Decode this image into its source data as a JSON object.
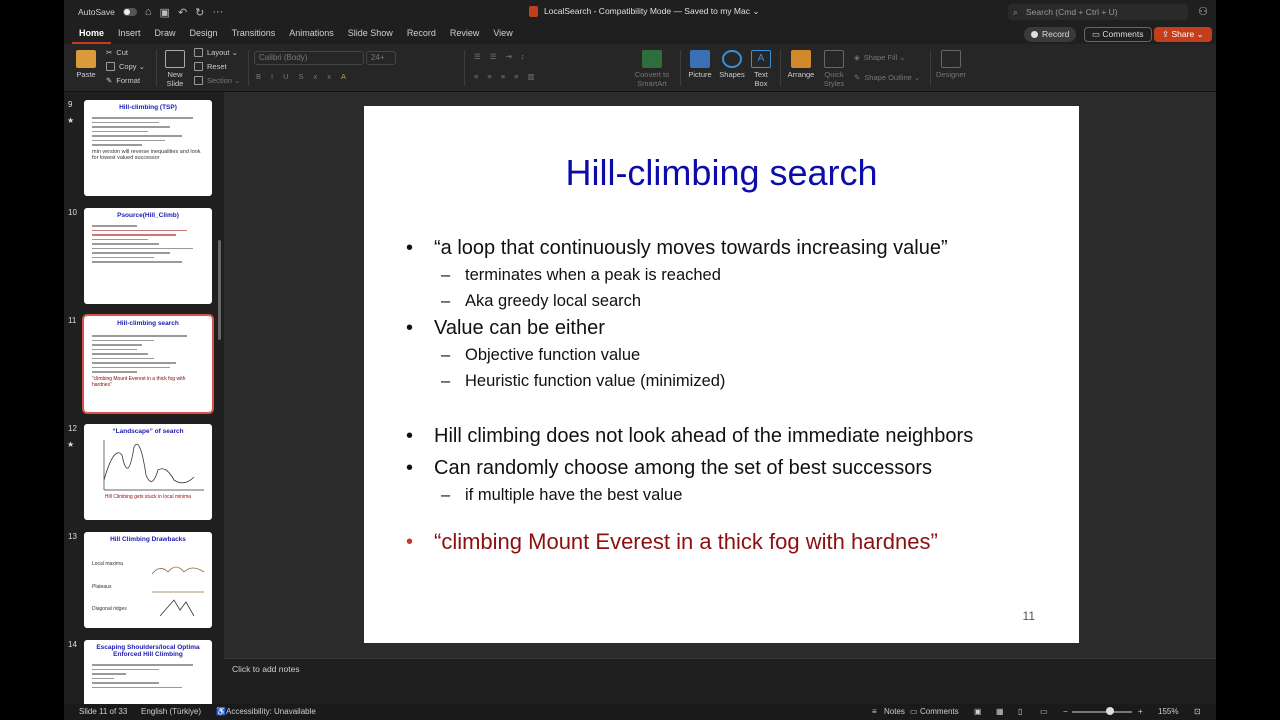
{
  "titlebar": {
    "autosave_label": "AutoSave",
    "document_title": "LocalSearch  -  Compatibility Mode  — Saved to my Mac ⌄",
    "search_placeholder": "Search (Cmd + Ctrl + U)"
  },
  "ribbon_tabs": [
    "Home",
    "Insert",
    "Draw",
    "Design",
    "Transitions",
    "Animations",
    "Slide Show",
    "Record",
    "Review",
    "View"
  ],
  "header_buttons": {
    "record": "Record",
    "comments": "Comments",
    "share": "Share ⌄"
  },
  "ribbon": {
    "paste": "Paste",
    "cut": "Cut",
    "copy": "Copy ⌄",
    "format": "Format",
    "new_slide": "New Slide",
    "layout": "Layout ⌄",
    "reset": "Reset",
    "section": "Section ⌄",
    "font_name": "Calibri (Body)",
    "font_size": "24+",
    "convert_smartart": "Convert to SmartArt",
    "picture": "Picture",
    "shapes": "Shapes",
    "text_box": "Text Box",
    "arrange": "Arrange",
    "quick_styles": "Quick Styles",
    "shape_fill": "Shape Fill ⌄",
    "shape_outline": "Shape Outline ⌄",
    "designer": "Designer"
  },
  "thumbnails": [
    {
      "num": "9",
      "title": "Hill-climbing (TSP)",
      "footer": "min version will reverse inequalities and look for lowest valued successor",
      "star": true
    },
    {
      "num": "10",
      "title": "Psource(Hill_Climb)",
      "footer": "",
      "star": false
    },
    {
      "num": "11",
      "title": "Hill-climbing search",
      "footer": "“climbing Mount Everest in a thick fog with hardnes”",
      "star": false
    },
    {
      "num": "12",
      "title": "“Landscape” of search",
      "footer": "Hill Climbing gets stuck in local minima",
      "star": true
    },
    {
      "num": "13",
      "title": "Hill Climbing Drawbacks",
      "footer": "",
      "star": false
    },
    {
      "num": "14",
      "title": "Escaping Shoulders/local Optima Enforced Hill Climbing",
      "footer": "",
      "star": false
    }
  ],
  "thumb13_items": [
    "Local maxima",
    "Plateaux",
    "Diagonal ridges"
  ],
  "slide": {
    "title": "Hill-climbing search",
    "bullets": [
      {
        "level": 1,
        "text": "“a loop that continuously moves towards increasing value”"
      },
      {
        "level": 2,
        "text": "terminates when a peak is reached"
      },
      {
        "level": 2,
        "text": "Aka greedy local search"
      },
      {
        "level": 1,
        "text": "Value can be either"
      },
      {
        "level": 2,
        "text": "Objective function value"
      },
      {
        "level": 2,
        "text": "Heuristic function value (minimized)"
      },
      {
        "level": 1,
        "text": "Hill climbing does not look ahead of the immediate neighbors"
      },
      {
        "level": 1,
        "text": "Can randomly choose among the set of best successors"
      },
      {
        "level": 2,
        "text": "if multiple have the best value"
      },
      {
        "level": 1,
        "text": "“climbing Mount Everest in a thick fog with hardnes”",
        "color": "#8b1010"
      }
    ],
    "number": "11"
  },
  "notes_placeholder": "Click to add notes",
  "status": {
    "slide_counter": "Slide 11 of 33",
    "language": "English (Türkiye)",
    "accessibility": "Accessibility: Unavailable",
    "notes": "Notes",
    "comments": "Comments",
    "zoom": "155%"
  },
  "colors": {
    "accent": "#c43e1c",
    "slide_title": "#0c0ca8",
    "selection": "#d9534f"
  }
}
